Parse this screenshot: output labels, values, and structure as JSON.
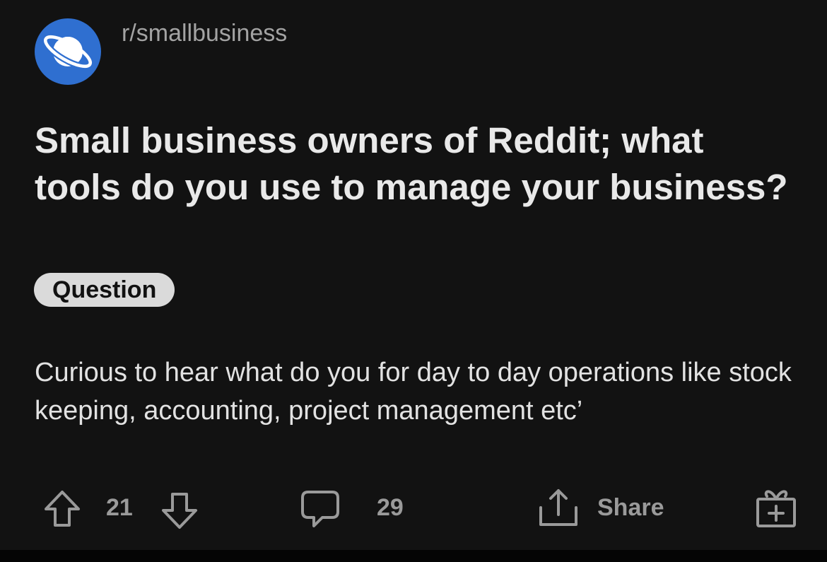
{
  "post": {
    "subreddit": "r/smallbusiness",
    "title": "Small business owners of Reddit; what tools do you use to manage your business?",
    "flair": "Question",
    "body": "Curious to hear what do you for day to day operations like stock keeping, accounting, project management etc’"
  },
  "actions": {
    "upvote_icon": "arrow-up-icon",
    "vote_count": "21",
    "downvote_icon": "arrow-down-icon",
    "comment_icon": "speech-bubble-icon",
    "comment_count": "29",
    "share_icon": "share-icon",
    "share_label": "Share",
    "award_icon": "gift-icon"
  },
  "colors": {
    "background": "#121212",
    "subreddit_icon": "#2f6fd0",
    "title_text": "#e9e9e9",
    "muted_text": "#9a9a9a",
    "flair_bg": "#dadada"
  }
}
